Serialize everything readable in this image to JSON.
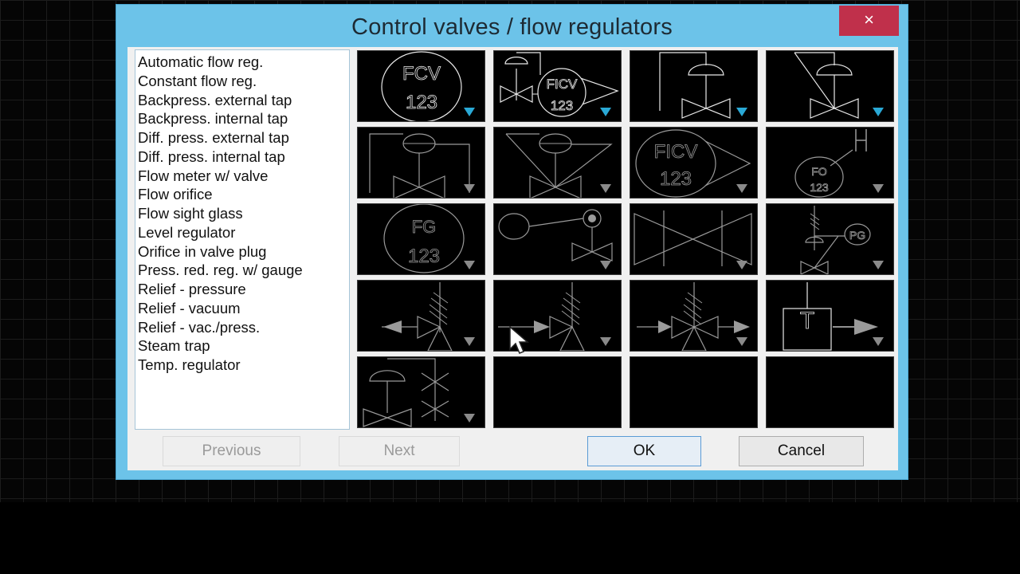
{
  "dialog": {
    "title": "Control valves / flow regulators",
    "close_label": "×"
  },
  "list": {
    "items": [
      "Automatic flow reg.",
      "Constant flow reg.",
      "Backpress. external tap",
      "Backpress. internal tap",
      "Diff. press. external tap",
      "Diff. press. internal tap",
      "Flow meter w/ valve",
      "Flow orifice",
      "Flow sight glass",
      "Level regulator",
      "Orifice in valve plug",
      "Press. red. reg. w/ gauge",
      "Relief - pressure",
      "Relief - vacuum",
      "Relief - vac./press.",
      "Steam trap",
      "Temp. regulator"
    ]
  },
  "tiles": [
    {
      "symbol": "automatic-flow-reg",
      "text1": "FCV",
      "text2": "123",
      "active": true
    },
    {
      "symbol": "constant-flow-reg",
      "text1": "FICV",
      "text2": "123",
      "active": true
    },
    {
      "symbol": "backpress-external-tap",
      "active": true
    },
    {
      "symbol": "backpress-internal-tap",
      "active": true
    },
    {
      "symbol": "diff-press-external-tap",
      "active": false
    },
    {
      "symbol": "diff-press-internal-tap",
      "active": false
    },
    {
      "symbol": "flow-meter-w-valve",
      "text1": "FICV",
      "text2": "123",
      "active": false
    },
    {
      "symbol": "flow-orifice",
      "text1": "FO",
      "text2": "123",
      "active": false
    },
    {
      "symbol": "flow-sight-glass",
      "text1": "FG",
      "text2": "123",
      "active": false
    },
    {
      "symbol": "level-regulator",
      "active": false
    },
    {
      "symbol": "orifice-in-valve-plug",
      "active": false
    },
    {
      "symbol": "press-red-reg-w-gauge",
      "text1": "PG",
      "active": false
    },
    {
      "symbol": "relief-pressure",
      "active": false
    },
    {
      "symbol": "relief-vacuum",
      "active": false
    },
    {
      "symbol": "relief-vac-press",
      "active": false
    },
    {
      "symbol": "steam-trap",
      "text1": "T",
      "active": false
    },
    {
      "symbol": "temp-regulator",
      "active": false
    },
    {
      "symbol": "empty"
    },
    {
      "symbol": "empty"
    },
    {
      "symbol": "empty"
    }
  ],
  "buttons": {
    "previous": "Previous",
    "next": "Next",
    "ok": "OK",
    "cancel": "Cancel"
  },
  "colors": {
    "title_bar": "#6cc3e9",
    "close": "#c0304b",
    "active_arrow": "#2aa9d6",
    "inactive_arrow": "#8a8a8a"
  }
}
